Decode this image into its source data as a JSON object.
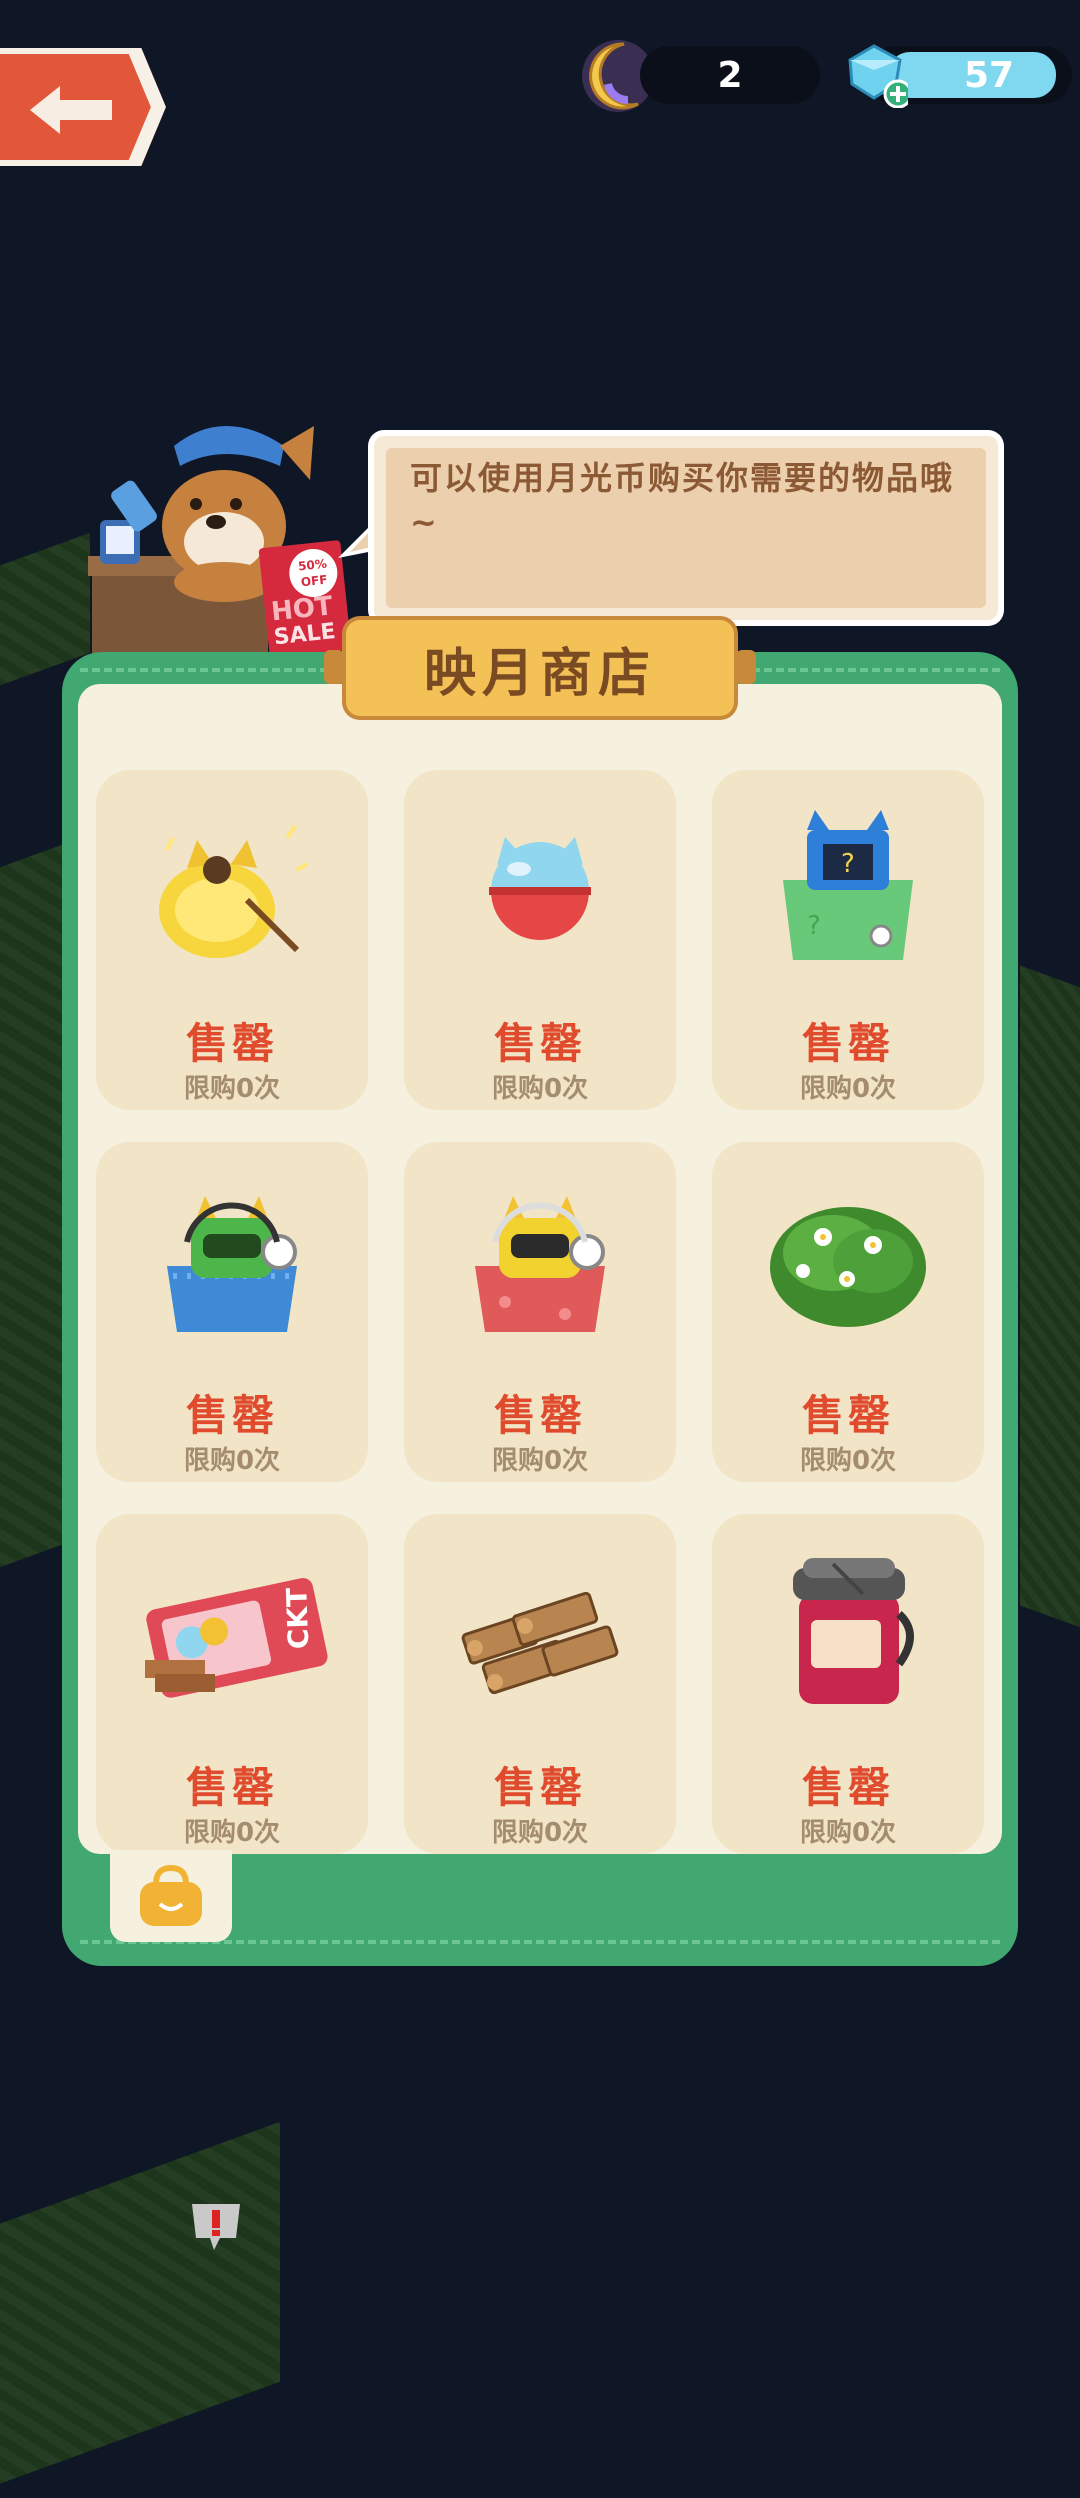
{
  "currencies": {
    "moon_coins": "2",
    "gems": "57"
  },
  "npc": {
    "speech": "可以使用月光币购买你需要的物品哦~",
    "sale_sign": {
      "percent": "50%",
      "off": "OFF",
      "hot": "HOT",
      "sale": "SALE"
    }
  },
  "shop": {
    "title": "映月商店",
    "items": [
      {
        "icon": "golden-cat-flask-icon",
        "status": "售罄",
        "limit": "限购0次"
      },
      {
        "icon": "cat-gacha-capsule-icon",
        "status": "售罄",
        "limit": "限购0次"
      },
      {
        "icon": "mystery-box-icon",
        "status": "售罄",
        "limit": "限购0次"
      },
      {
        "icon": "green-robot-chest-icon",
        "status": "售罄",
        "limit": "限购0次"
      },
      {
        "icon": "yellow-robot-chest-icon",
        "status": "售罄",
        "limit": "限购0次"
      },
      {
        "icon": "flower-bush-icon",
        "status": "售罄",
        "limit": "限购0次"
      },
      {
        "icon": "ticket-icon",
        "status": "售罄",
        "limit": "限购0次",
        "ticket_text": "CKT"
      },
      {
        "icon": "wood-logs-icon",
        "status": "售罄",
        "limit": "限购0次"
      },
      {
        "icon": "jam-jar-icon",
        "status": "售罄",
        "limit": "限购0次"
      }
    ]
  },
  "colors": {
    "panel_green": "#40a870",
    "sold_red": "#e04b2e",
    "banner_gold": "#f3c155"
  }
}
